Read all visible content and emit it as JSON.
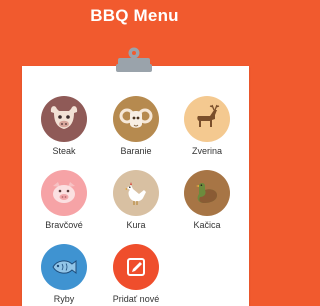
{
  "header": {
    "title": "BBQ Menu"
  },
  "menu": {
    "items": [
      {
        "label": "Steak",
        "icon": "cow-icon",
        "color": "#8f5a57"
      },
      {
        "label": "Baranie",
        "icon": "ram-icon",
        "color": "#b68a4f"
      },
      {
        "label": "Zverina",
        "icon": "deer-icon",
        "color": "#f4c990"
      },
      {
        "label": "Bravčové",
        "icon": "pig-icon",
        "color": "#f6a3a6"
      },
      {
        "label": "Kura",
        "icon": "chicken-icon",
        "color": "#d8c0a2"
      },
      {
        "label": "Kačica",
        "icon": "duck-icon",
        "color": "#a77545"
      },
      {
        "label": "Ryby",
        "icon": "fish-icon",
        "color": "#3f93d1"
      },
      {
        "label": "Pridať nové",
        "icon": "edit-icon",
        "color": "#ef4e2c"
      }
    ]
  },
  "colors": {
    "background": "#f15a2e",
    "card": "#ffffff",
    "clip": "#9aa3ab"
  }
}
